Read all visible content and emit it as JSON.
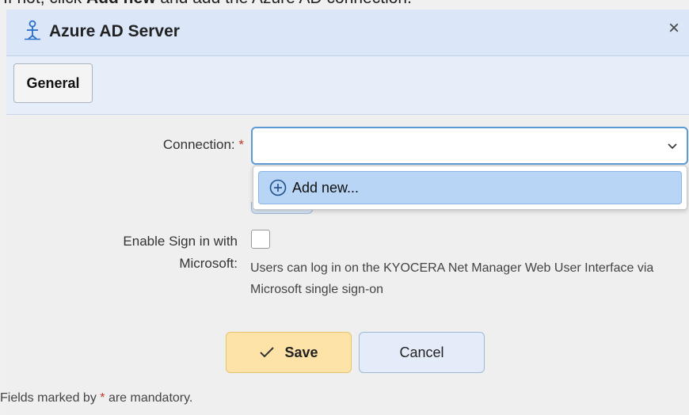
{
  "instruction": {
    "prefix": "If not, click ",
    "bold": "Add new",
    "suffix": " and add the Azure AD connection."
  },
  "dialog": {
    "title": "Azure AD Server",
    "close_label": "×"
  },
  "tabs": [
    {
      "label": "General"
    }
  ],
  "form": {
    "connection_label": "Connection:",
    "required_mark": "*",
    "connection_value": "",
    "dropdown_item": "Add new...",
    "sign_in_label_line1": "Enable Sign in with",
    "sign_in_label_line2": "Microsoft:",
    "sign_in_checked": false,
    "sign_in_description": "Users can log in on the KYOCERA Net Manager Web User Interface via Microsoft single sign-on"
  },
  "actions": {
    "save_label": "Save",
    "cancel_label": "Cancel"
  },
  "footer": {
    "prefix": "Fields marked by ",
    "mark": "*",
    "suffix": " are mandatory."
  },
  "colors": {
    "accent": "#5b9bd5",
    "save_bg": "#fde3a8",
    "required": "#c0392b"
  }
}
